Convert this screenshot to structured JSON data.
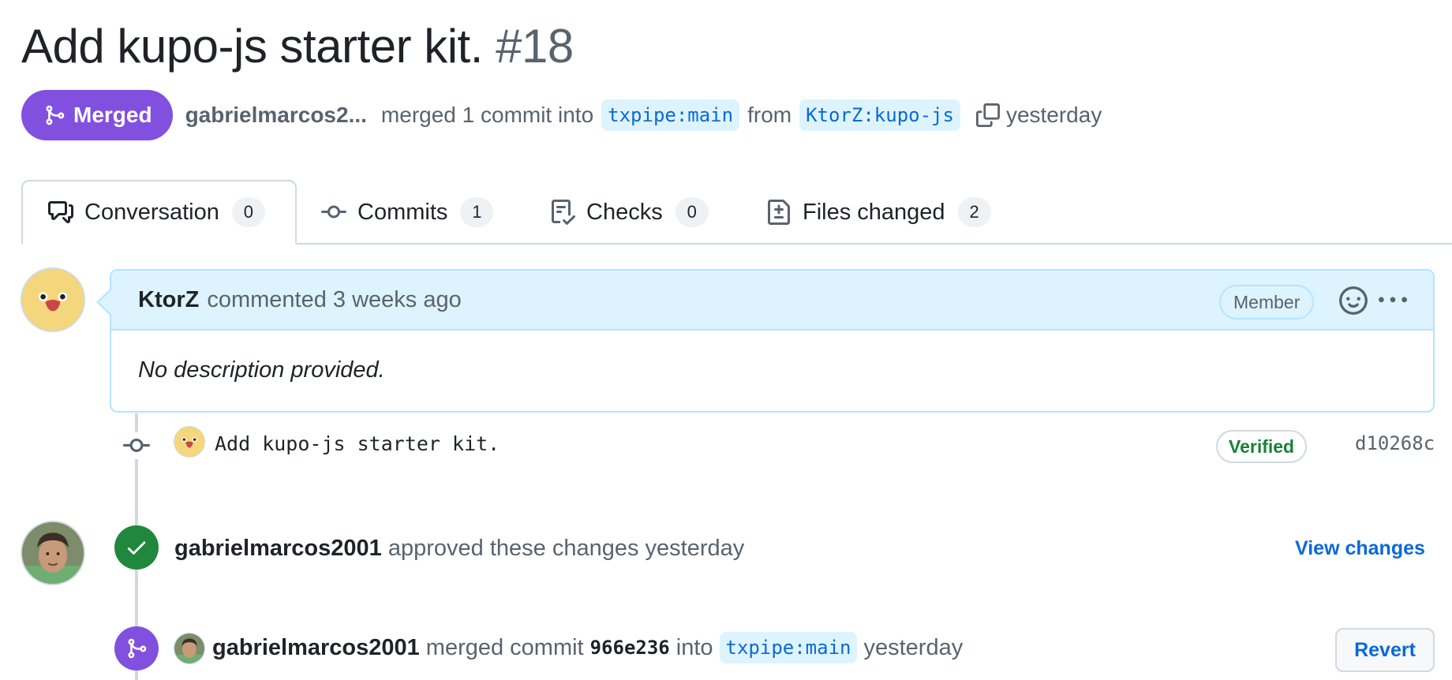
{
  "pr": {
    "title": "Add kupo-js starter kit.",
    "number": "#18",
    "state_label": "Merged",
    "merged_by": "gabrielmarcos2...",
    "merge_summary": "merged 1 commit into",
    "base_branch": "txpipe:main",
    "from_label": "from",
    "head_branch": "KtorZ:kupo-js",
    "merged_time": "yesterday"
  },
  "tabs": [
    {
      "label": "Conversation",
      "count": "0",
      "icon": "comment-discussion-icon",
      "active": true
    },
    {
      "label": "Commits",
      "count": "1",
      "icon": "git-commit-icon",
      "active": false
    },
    {
      "label": "Checks",
      "count": "0",
      "icon": "checklist-icon",
      "active": false
    },
    {
      "label": "Files changed",
      "count": "2",
      "icon": "file-diff-icon",
      "active": false
    }
  ],
  "comment": {
    "author": "KtorZ",
    "action": "commented 3 weeks ago",
    "badge": "Member",
    "body": "No description provided."
  },
  "commit": {
    "message": "Add kupo-js starter kit.",
    "verified_label": "Verified",
    "sha": "d10268c"
  },
  "review": {
    "author": "gabrielmarcos2001",
    "action": "approved these changes yesterday",
    "link_label": "View changes"
  },
  "merge_event": {
    "author": "gabrielmarcos2001",
    "action": "merged commit",
    "sha": "966e236",
    "into_label": "into",
    "branch": "txpipe:main",
    "time": "yesterday",
    "revert_label": "Revert"
  },
  "colors": {
    "merged_purple": "#8250df",
    "approved_green": "#1f883d",
    "link_blue": "#0969da",
    "comment_header_bg": "#ddf4ff"
  }
}
